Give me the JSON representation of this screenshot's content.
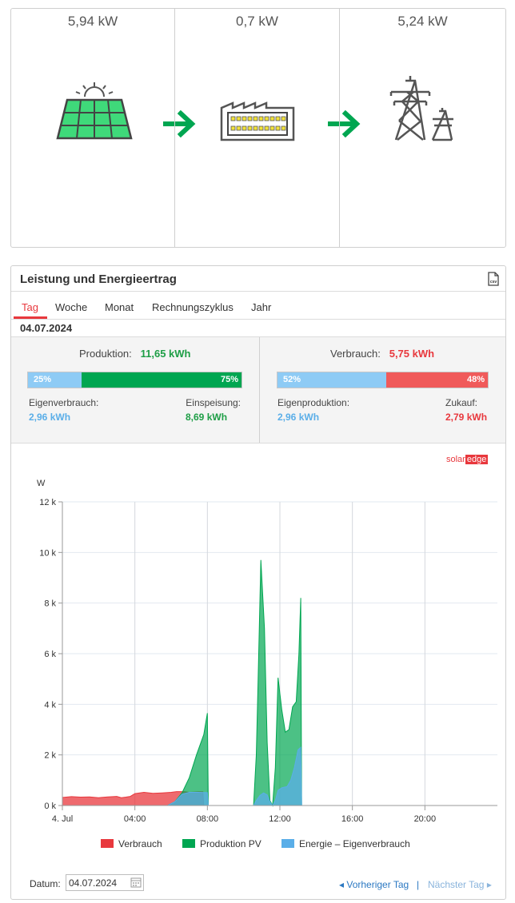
{
  "flow": {
    "pv_power": "5,94 kW",
    "consumption_power": "0,7 kW",
    "grid_power": "5,24 kW",
    "accent_color": "#00a651"
  },
  "panel": {
    "title": "Leistung und Energieertrag",
    "csv_label": "csv",
    "tabs": [
      "Tag",
      "Woche",
      "Monat",
      "Rechnungszyklus",
      "Jahr"
    ],
    "active_tab": "Tag",
    "date": "04.07.2024"
  },
  "production": {
    "label": "Produktion:",
    "value": "11,65 kWh",
    "self_pct": "25%",
    "export_pct": "75%",
    "self_label": "Eigenverbrauch:",
    "self_value": "2,96 kWh",
    "export_label": "Einspeisung:",
    "export_value": "8,69 kWh"
  },
  "consumption": {
    "label": "Verbrauch:",
    "value": "5,75 kWh",
    "self_pct": "52%",
    "import_pct": "48%",
    "self_label": "Eigenproduktion:",
    "self_value": "2,96 kWh",
    "import_label": "Zukauf:",
    "import_value": "2,79 kWh"
  },
  "logo": {
    "part1": "solar",
    "part2": "edge"
  },
  "colors": {
    "consumption": "#e8383d",
    "production": "#00a651",
    "self_consumption": "#5aaee8",
    "light_blue": "#8ecbf5",
    "bar_green": "#00a651",
    "bar_red": "#f05a5a",
    "green_text": "#1e9e46",
    "red_text": "#e8383d",
    "blue_text": "#5aaee8",
    "link": "#2b78c2"
  },
  "chart_data": {
    "type": "area",
    "ylabel": "W",
    "y_ticks": [
      "0 k",
      "2 k",
      "4 k",
      "6 k",
      "8 k",
      "10 k",
      "12 k"
    ],
    "x_ticks": [
      "4. Jul",
      "04:00",
      "08:00",
      "12:00",
      "16:00",
      "20:00"
    ],
    "ylim": [
      0,
      12000
    ],
    "xlim_hours": [
      0,
      24
    ],
    "grid": true,
    "legend_position": "bottom",
    "series": [
      {
        "name": "Verbrauch",
        "color": "#e8383d",
        "points": [
          [
            0,
            320
          ],
          [
            0.5,
            350
          ],
          [
            1,
            330
          ],
          [
            1.5,
            340
          ],
          [
            2,
            310
          ],
          [
            2.5,
            340
          ],
          [
            3,
            360
          ],
          [
            3.25,
            310
          ],
          [
            3.5,
            330
          ],
          [
            3.75,
            360
          ],
          [
            4,
            470
          ],
          [
            4.5,
            520
          ],
          [
            5,
            480
          ],
          [
            5.5,
            500
          ],
          [
            6,
            520
          ],
          [
            6.3,
            550
          ],
          [
            6.7,
            550
          ],
          [
            7,
            520
          ],
          [
            7.5,
            540
          ],
          [
            7.75,
            540
          ],
          [
            7.8,
            0
          ]
        ]
      },
      {
        "name": "Produktion PV",
        "color": "#00a651",
        "points": [
          [
            5.8,
            0
          ],
          [
            6.2,
            150
          ],
          [
            6.6,
            500
          ],
          [
            7,
            1100
          ],
          [
            7.4,
            2000
          ],
          [
            7.8,
            2800
          ],
          [
            8,
            3650
          ],
          [
            8.05,
            0
          ],
          [
            10.55,
            0
          ],
          [
            10.7,
            2000
          ],
          [
            10.8,
            5000
          ],
          [
            10.95,
            9700
          ],
          [
            11.15,
            7000
          ],
          [
            11.3,
            2500
          ],
          [
            11.45,
            200
          ],
          [
            11.6,
            0
          ],
          [
            11.75,
            1500
          ],
          [
            11.9,
            5050
          ],
          [
            12.1,
            3800
          ],
          [
            12.3,
            2900
          ],
          [
            12.5,
            3000
          ],
          [
            12.7,
            3900
          ],
          [
            12.9,
            4100
          ],
          [
            13.05,
            6000
          ],
          [
            13.15,
            8200
          ],
          [
            13.2,
            0
          ]
        ]
      },
      {
        "name": "Energie – Eigenverbrauch",
        "color": "#5aaee8",
        "points": [
          [
            5.8,
            0
          ],
          [
            6.2,
            150
          ],
          [
            6.6,
            450
          ],
          [
            7,
            520
          ],
          [
            7.5,
            520
          ],
          [
            8,
            510
          ],
          [
            8.05,
            0
          ],
          [
            10.55,
            0
          ],
          [
            10.7,
            200
          ],
          [
            10.9,
            400
          ],
          [
            11.1,
            500
          ],
          [
            11.3,
            420
          ],
          [
            11.45,
            150
          ],
          [
            11.6,
            0
          ],
          [
            11.75,
            200
          ],
          [
            11.9,
            600
          ],
          [
            12.1,
            700
          ],
          [
            12.4,
            750
          ],
          [
            12.6,
            1000
          ],
          [
            12.8,
            1500
          ],
          [
            13,
            2200
          ],
          [
            13.15,
            2300
          ],
          [
            13.2,
            0
          ]
        ]
      }
    ]
  },
  "footer": {
    "datum_label": "Datum:",
    "datum_value": "04.07.2024",
    "prev_label": "Vorheriger Tag",
    "separator": "|",
    "next_label": "Nächster Tag"
  }
}
